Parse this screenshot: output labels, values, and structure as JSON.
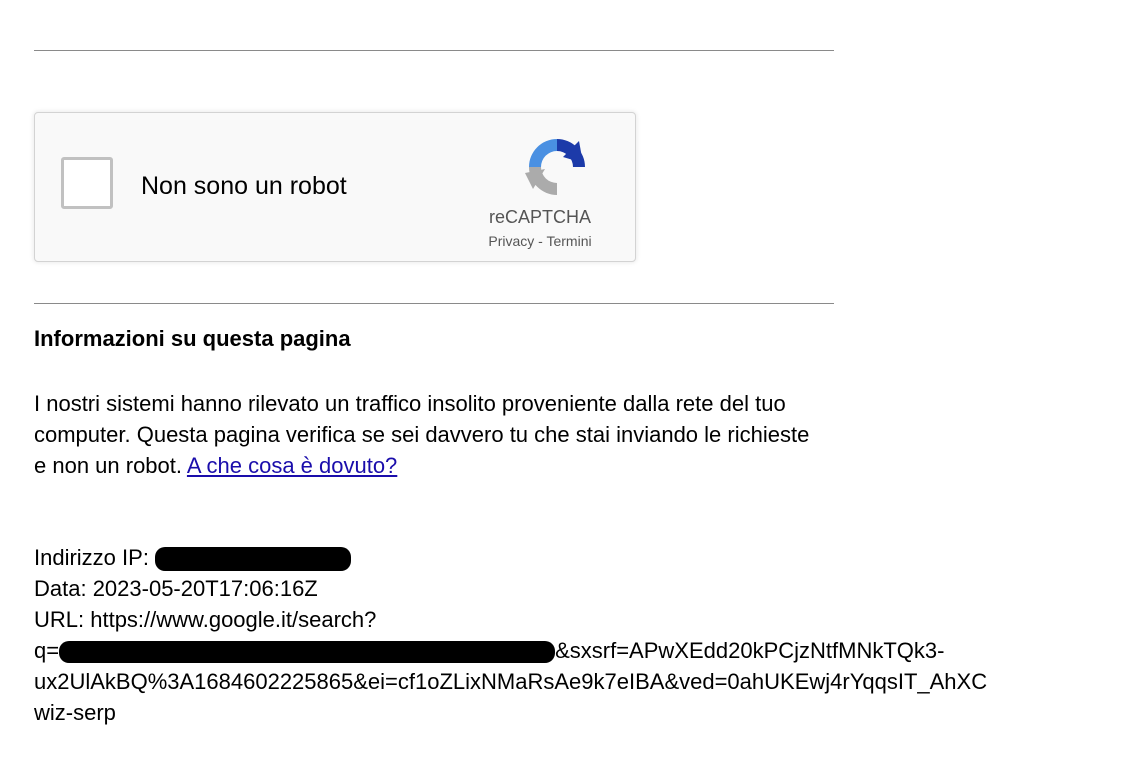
{
  "captcha": {
    "checkbox_label": "Non sono un robot",
    "brand": "reCAPTCHA",
    "privacy_link": "Privacy",
    "separator": " - ",
    "terms_link": "Termini",
    "logo_icon": "recaptcha-logo-icon"
  },
  "info": {
    "title": "Informazioni su questa pagina",
    "body": "I nostri sistemi hanno rilevato un traffico insolito proveniente dalla rete del tuo computer. Questa pagina verifica se sei davvero tu che stai inviando le richieste e non un robot.",
    "link": "A che cosa è dovuto?"
  },
  "meta": {
    "ip_label": "Indirizzo IP: ",
    "date_line": "Data: 2023-05-20T17:06:16Z",
    "url_line": "URL: https://www.google.it/search?",
    "query_prefix": "q=",
    "query_rest": "&sxsrf=APwXEdd20kPCjzNtfMNkTQk3-",
    "query_line2": "ux2UlAkBQ%3A1684602225865&ei=cf1oZLixNMaRsAe9k7eIBA&ved=0ahUKEwj4rYqqsIT_AhXC",
    "query_line3": "wiz-serp"
  }
}
